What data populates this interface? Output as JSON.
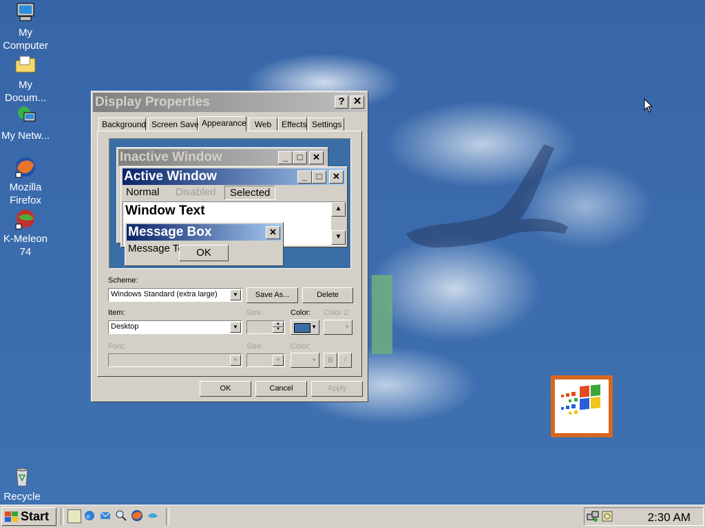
{
  "desktop": {
    "icons": [
      {
        "label": "My Computer"
      },
      {
        "label": "My Docum..."
      },
      {
        "label": "My Netw..."
      },
      {
        "label": "Mozilla Firefox"
      },
      {
        "label": "K-Meleon 74"
      },
      {
        "label": "Recycle"
      }
    ]
  },
  "dialog": {
    "title": "Display Properties",
    "help_button": "?",
    "close_button": "✕",
    "tabs": [
      "Background",
      "Screen Saver",
      "Appearance",
      "Web",
      "Effects",
      "Settings"
    ],
    "active_tab": "Appearance",
    "preview": {
      "inactive_title": "Inactive Window",
      "active_title": "Active Window",
      "menu_normal": "Normal",
      "menu_disabled": "Disabled",
      "menu_selected": "Selected",
      "window_text": "Window Text",
      "message_box_title": "Message Box",
      "message_text": "Message Text",
      "ok_button": "OK"
    },
    "scheme_label": "Scheme:",
    "scheme_value": "Windows Standard (extra large)",
    "save_as_button": "Save As...",
    "delete_button": "Delete",
    "item_label": "Item:",
    "item_value": "Desktop",
    "item_size_label": "Size:",
    "color_label": "Color:",
    "color2_label": "Color 2:",
    "font_label": "Font:",
    "font_size_label": "Size:",
    "font_color_label": "Color:",
    "bold_button": "B",
    "italic_button": "I",
    "ok_button": "OK",
    "cancel_button": "Cancel",
    "apply_button": "Apply",
    "desktop_color": "#3a6ea5"
  },
  "taskbar": {
    "start_label": "Start",
    "clock": "2:30 AM"
  }
}
